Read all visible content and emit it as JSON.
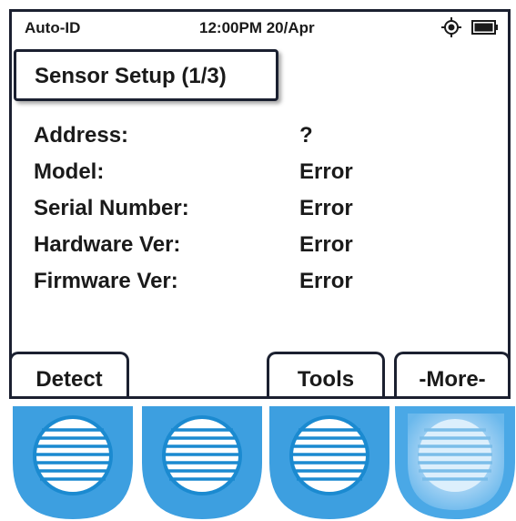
{
  "status_bar": {
    "mode": "Auto-ID",
    "time_date": "12:00PM 20/Apr",
    "icons": [
      "gps-target-icon",
      "battery-icon"
    ]
  },
  "title": "Sensor Setup (1/3)",
  "info_rows": [
    {
      "label": "Address:",
      "value": "?"
    },
    {
      "label": "Model:",
      "value": "Error"
    },
    {
      "label": "Serial Number:",
      "value": "Error"
    },
    {
      "label": "Hardware Ver:",
      "value": "Error"
    },
    {
      "label": "Firmware Ver:",
      "value": "Error"
    }
  ],
  "softkeys": {
    "key1": "Detect",
    "key2": "",
    "key3": "Tools",
    "key4": "-More-"
  },
  "hardware_buttons": {
    "count": 4,
    "pressed_index": 4,
    "color": "#3d9fe0",
    "pressed_glow": "#cfe8fb"
  },
  "colors": {
    "screen_border": "#1b2030",
    "text": "#1a1a1a",
    "button_blue": "#3d9fe0"
  }
}
